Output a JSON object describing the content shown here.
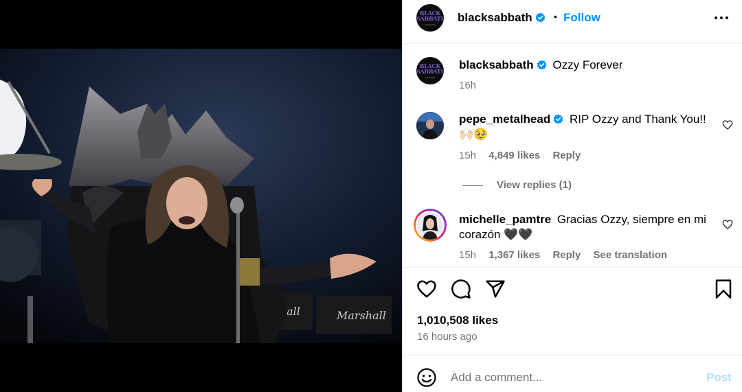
{
  "post": {
    "image_alt_icon": "concert-photo-throne",
    "author": {
      "username": "blacksabbath",
      "verified": true,
      "logo_text_line1": "BLACK",
      "logo_text_line2": "SABBATH",
      "logo_sub": "1968-2025"
    },
    "follow_label": "Follow",
    "separator": "•"
  },
  "caption": {
    "username": "blacksabbath",
    "text": "Ozzy Forever",
    "time": "16h"
  },
  "comments": [
    {
      "username": "pepe_metalhead",
      "verified": true,
      "text": "RIP Ozzy and Thank You!! 🙌🏻🥹",
      "time": "15h",
      "likes": "4,849 likes",
      "reply_label": "Reply",
      "view_replies": "View replies (1)"
    },
    {
      "username": "michelle_pamtre",
      "verified": false,
      "text": "Gracias Ozzy, siempre en mi corazón 🖤🖤",
      "time": "15h",
      "likes": "1,367 likes",
      "reply_label": "Reply",
      "translation_label": "See translation"
    }
  ],
  "engagement": {
    "likes": "1,010,508 likes",
    "time_ago": "16 hours ago"
  },
  "composer": {
    "placeholder": "Add a comment...",
    "post_label": "Post"
  },
  "colors": {
    "accent": "#0095f6",
    "muted": "#737373",
    "post_disabled": "#b2dffc",
    "verified": "#0095f6"
  }
}
